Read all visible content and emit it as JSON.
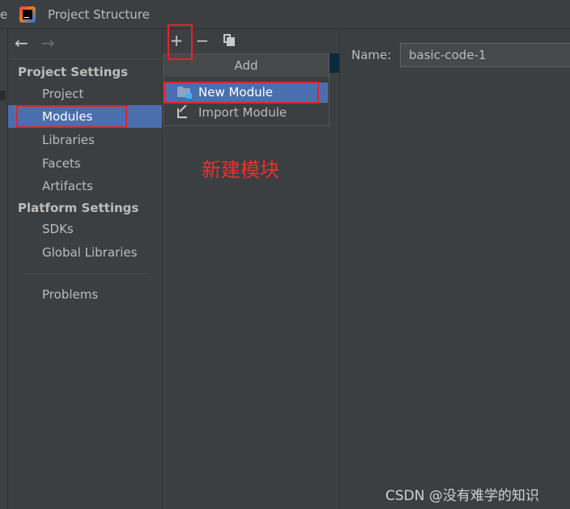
{
  "window": {
    "title_edge": "e",
    "title": "Project Structure"
  },
  "nav": {
    "back_icon": "←",
    "forward_icon": "→",
    "project_settings_label": "Project Settings",
    "project_settings_items": [
      "Project",
      "Modules",
      "Libraries",
      "Facets",
      "Artifacts"
    ],
    "platform_settings_label": "Platform Settings",
    "platform_settings_items": [
      "SDKs",
      "Global Libraries"
    ],
    "problems_label": "Problems",
    "selected": "Modules"
  },
  "toolbar": {
    "add_icon": "+",
    "remove_icon": "−",
    "copy_icon": "copy-icon"
  },
  "add_popup": {
    "header": "Add",
    "items": [
      {
        "label": "New Module",
        "icon": "folder-module-icon",
        "selected": true
      },
      {
        "label": "Import Module",
        "icon": "import-arrow-icon",
        "selected": false
      }
    ]
  },
  "annotation": {
    "text": "新建模块",
    "color": "#e8302f"
  },
  "detail": {
    "name_label": "Name:",
    "name_value": "basic-code-1"
  },
  "watermark": "CSDN @没有难学的知识",
  "colors": {
    "background": "#3c3f41",
    "selection": "#4b6eaf",
    "annotation_red": "#e0242c"
  }
}
